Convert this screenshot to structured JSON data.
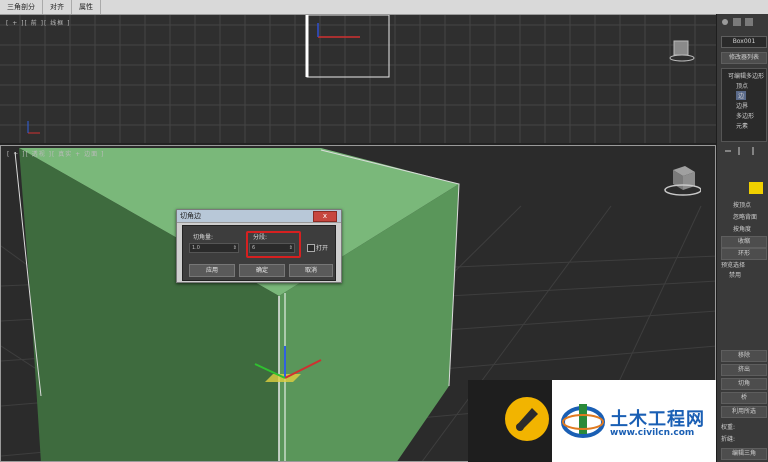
{
  "menu": [
    "三角剖分",
    "对齐",
    "属性"
  ],
  "top_viewport_label": "[ + ][ 前 ][ 线框 ]",
  "persp_viewport_label": "[ + ][ 透视 ][ 真实 + 边面 ]",
  "command_panel": {
    "name_field": "Box001",
    "modifier_list": "修改器列表",
    "stack": [
      "可编辑多边形",
      "顶点",
      "边",
      "边界",
      "多边形",
      "元素"
    ],
    "buttons": [
      "按顶点",
      "忽略背面",
      "按角度",
      "收缩",
      "环形",
      "预览选择",
      "禁用",
      "移除",
      "挤出",
      "切角",
      "桥",
      "利用所选",
      "编辑三角"
    ],
    "weight_label": "权重:",
    "crease_label": "折缝:"
  },
  "dialog": {
    "title": "切角边",
    "close_glyph": "x",
    "amount_label": "切角量:",
    "amount_value": "1.0",
    "segments_label": "分段:",
    "segments_value": "6",
    "open_label": "打开",
    "apply_label": "应用",
    "ok_label": "确定",
    "cancel_label": "取消"
  },
  "watermark": {
    "name": "土木工程网",
    "url": "www.civilcn.com"
  },
  "colors": {
    "box_front": "#4e8a4e",
    "box_side": "#3d6f3d",
    "box_top": "#7ab87a",
    "grid": "#3f3f3f",
    "highlight": "#d62020",
    "brand": "#1a5fb4"
  }
}
